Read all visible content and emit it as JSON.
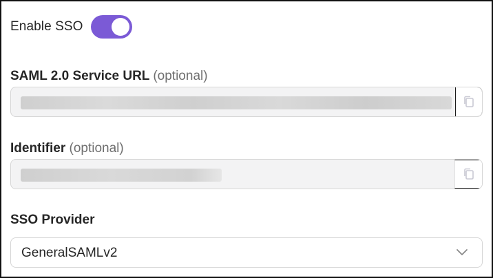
{
  "sso_toggle": {
    "label": "Enable SSO",
    "enabled": true
  },
  "saml_service_url": {
    "label": "SAML 2.0 Service URL",
    "optional_hint": "(optional)",
    "value": "",
    "copy_icon": "copy-icon"
  },
  "identifier": {
    "label": "Identifier",
    "optional_hint": "(optional)",
    "value": "",
    "copy_icon": "copy-icon"
  },
  "sso_provider": {
    "label": "SSO Provider",
    "selected": "GeneralSAMLv2",
    "chevron_icon": "chevron-down-icon"
  },
  "colors": {
    "accent": "#7b5ad6",
    "field_background": "#f3f3f4",
    "border": "#d6d6d6"
  }
}
